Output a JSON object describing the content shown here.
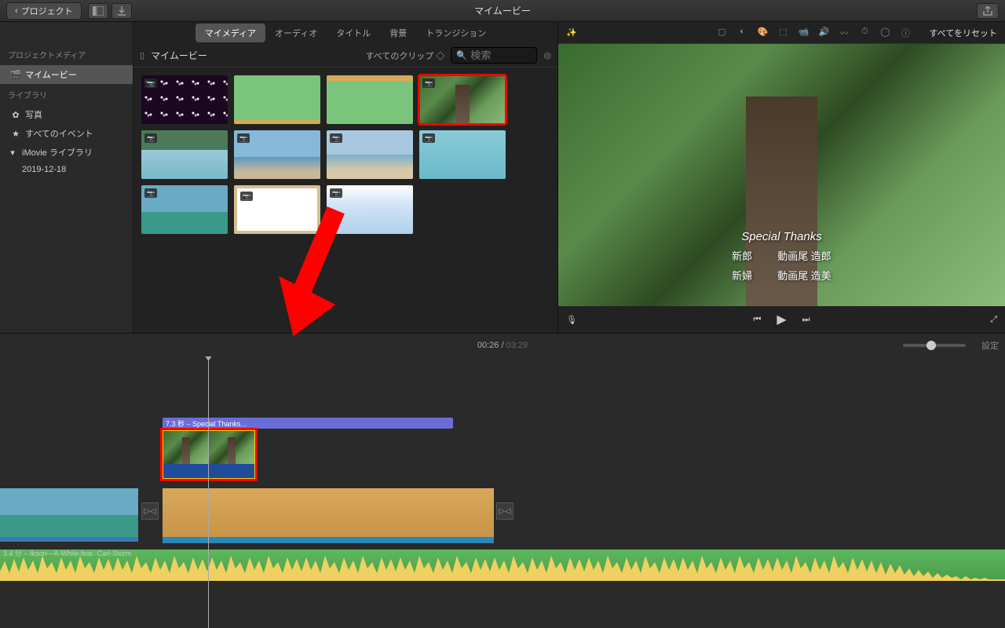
{
  "toolbar": {
    "back_label": "プロジェクト",
    "title": "マイムービー"
  },
  "sidebar": {
    "project_media_header": "プロジェクトメディア",
    "project_name": "マイムービー",
    "library_header": "ライブラリ",
    "photos_label": "写真",
    "all_events_label": "すべてのイベント",
    "imovie_library_label": "iMovie ライブラリ",
    "event_date": "2019-12-18"
  },
  "media_tabs": {
    "my_media": "マイメディア",
    "audio": "オーディオ",
    "title": "タイトル",
    "background": "背景",
    "transition": "トランジション"
  },
  "media_header": {
    "title": "マイムービー",
    "clip_filter": "すべてのクリップ",
    "search_placeholder": "検索"
  },
  "preview": {
    "reset_label": "すべてをリセット",
    "overlay_title": "Special Thanks",
    "credit_role_1": "新郎",
    "credit_name_1": "動画尾 造郎",
    "credit_role_2": "新婦",
    "credit_name_2": "動画尾 造美"
  },
  "playhead": {
    "current": "00:26",
    "total": "03:29",
    "settings_label": "設定"
  },
  "timeline": {
    "title_clip_label": "7.3 秒 – Special Thanks...",
    "audio_clip_label": "3.4 分 – Ikson---A-While-feat.-Carl-Storm"
  }
}
